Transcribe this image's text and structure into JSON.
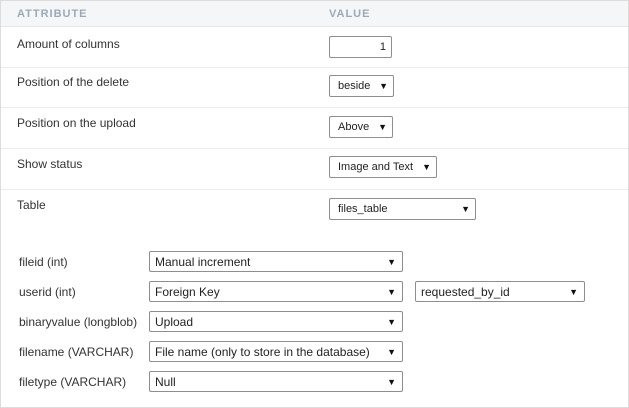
{
  "header": {
    "attribute_label": "ATTRIBUTE",
    "value_label": "VALUE"
  },
  "rows": [
    {
      "label": "Amount of columns",
      "value": "1"
    },
    {
      "label": "Position of the delete",
      "value": "beside"
    },
    {
      "label": "Position on the upload",
      "value": "Above"
    },
    {
      "label": "Show status",
      "value": "Image and Text"
    },
    {
      "label": "Table",
      "value": "files_table"
    }
  ],
  "fields": [
    {
      "label": "fileid (int)",
      "value": "Manual increment"
    },
    {
      "label": "userid (int)",
      "value": "Foreign Key",
      "extra": "requested_by_id"
    },
    {
      "label": "binaryvalue (longblob)",
      "value": "Upload"
    },
    {
      "label": "filename (VARCHAR)",
      "value": "File name (only to store in the database)"
    },
    {
      "label": "filetype (VARCHAR)",
      "value": "Null"
    }
  ],
  "icons": {
    "dropdown": "dropdown-arrow-icon"
  },
  "colors": {
    "header_bg": "#f4f6f8",
    "header_text": "#9aaab9",
    "border": "#8e8e8e"
  }
}
